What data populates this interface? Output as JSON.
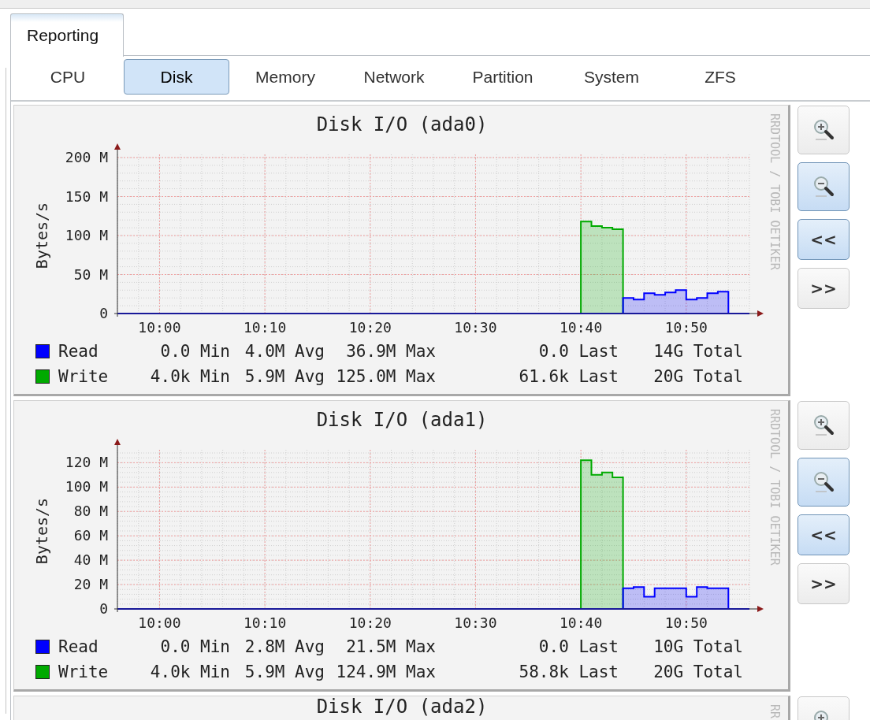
{
  "tabs": [
    {
      "label": "Reporting",
      "selected": true
    }
  ],
  "subtabs": [
    {
      "label": "CPU",
      "selected": false
    },
    {
      "label": "Disk",
      "selected": true
    },
    {
      "label": "Memory",
      "selected": false
    },
    {
      "label": "Network",
      "selected": false
    },
    {
      "label": "Partition",
      "selected": false
    },
    {
      "label": "System",
      "selected": false
    },
    {
      "label": "ZFS",
      "selected": false
    }
  ],
  "graphs": [
    {
      "watermark": "RRDTOOL / TOBI OETIKER",
      "chart_data": {
        "type": "area",
        "title": "Disk I/O (ada0)",
        "ylabel": "Bytes/s",
        "grid": true,
        "ylim": [
          0,
          200
        ],
        "categories": [
          null,
          null,
          null,
          null,
          "10:00",
          null,
          null,
          null,
          null,
          null,
          null,
          null,
          null,
          null,
          "10:10",
          null,
          null,
          null,
          null,
          null,
          null,
          null,
          null,
          null,
          "10:20",
          null,
          null,
          null,
          null,
          null,
          null,
          null,
          null,
          null,
          "10:30",
          null,
          null,
          null,
          null,
          null,
          null,
          null,
          null,
          null,
          "10:40",
          null,
          null,
          null,
          null,
          null,
          null,
          null,
          null,
          null,
          "10:50",
          null,
          null,
          null,
          null,
          null,
          null
        ],
        "series": [
          {
            "name": "Write",
            "color": "#00aa00",
            "values": [
              0,
              0,
              0,
              0,
              0,
              0,
              0,
              0,
              0,
              0,
              0,
              0,
              0,
              0,
              0,
              0,
              0,
              0,
              0,
              0,
              0,
              0,
              0,
              0,
              0,
              0,
              0,
              0,
              0,
              0,
              0,
              0,
              0,
              0,
              0,
              0,
              0,
              0,
              0,
              0,
              0,
              0,
              0,
              0,
              118,
              112,
              110,
              108,
              0,
              0,
              0,
              0,
              0,
              0,
              0,
              0,
              0,
              0,
              0,
              0,
              0
            ]
          },
          {
            "name": "Read",
            "color": "#0000ff",
            "values": [
              0,
              0,
              0,
              0,
              0,
              0,
              0,
              0,
              0,
              0,
              0,
              0,
              0,
              0,
              0,
              0,
              0,
              0,
              0,
              0,
              0,
              0,
              0,
              0,
              0,
              0,
              0,
              0,
              0,
              0,
              0,
              0,
              0,
              0,
              0,
              0,
              0,
              0,
              0,
              0,
              0,
              0,
              0,
              0,
              0,
              0,
              0,
              0,
              20,
              18,
              26,
              24,
              27,
              30,
              18,
              20,
              26,
              28,
              0,
              0,
              0
            ]
          }
        ],
        "yticks": [
          {
            "value": 0,
            "label": "0"
          },
          {
            "value": 50,
            "label": "50 M"
          },
          {
            "value": 100,
            "label": "100 M"
          },
          {
            "value": 150,
            "label": "150 M"
          },
          {
            "value": 200,
            "label": "200 M"
          }
        ]
      },
      "legend": [
        {
          "stats": [
            "0.0 Min",
            "4.0M Avg",
            "36.9M Max",
            "0.0 Last",
            "14G Total"
          ]
        },
        {
          "stats": [
            "4.0k Min",
            "5.9M Avg",
            "125.0M Max",
            "61.6k Last",
            "20G Total"
          ]
        }
      ],
      "buttons": [
        {
          "kind": "zoom-in",
          "highlighted": false
        },
        {
          "kind": "zoom-out",
          "highlighted": true
        },
        {
          "kind": "text",
          "label": "<<",
          "highlighted": true
        },
        {
          "kind": "text",
          "label": ">>",
          "highlighted": false
        }
      ]
    },
    {
      "watermark": "RRDTOOL / TOBI OETIKER",
      "chart_data": {
        "type": "area",
        "title": "Disk I/O (ada1)",
        "ylabel": "Bytes/s",
        "grid": true,
        "ylim": [
          0,
          128
        ],
        "categories": [
          null,
          null,
          null,
          null,
          "10:00",
          null,
          null,
          null,
          null,
          null,
          null,
          null,
          null,
          null,
          "10:10",
          null,
          null,
          null,
          null,
          null,
          null,
          null,
          null,
          null,
          "10:20",
          null,
          null,
          null,
          null,
          null,
          null,
          null,
          null,
          null,
          "10:30",
          null,
          null,
          null,
          null,
          null,
          null,
          null,
          null,
          null,
          "10:40",
          null,
          null,
          null,
          null,
          null,
          null,
          null,
          null,
          null,
          "10:50",
          null,
          null,
          null,
          null,
          null,
          null
        ],
        "series": [
          {
            "name": "Write",
            "color": "#00aa00",
            "values": [
              0,
              0,
              0,
              0,
              0,
              0,
              0,
              0,
              0,
              0,
              0,
              0,
              0,
              0,
              0,
              0,
              0,
              0,
              0,
              0,
              0,
              0,
              0,
              0,
              0,
              0,
              0,
              0,
              0,
              0,
              0,
              0,
              0,
              0,
              0,
              0,
              0,
              0,
              0,
              0,
              0,
              0,
              0,
              0,
              122,
              110,
              112,
              108,
              0,
              0,
              0,
              0,
              0,
              0,
              0,
              0,
              0,
              0,
              0,
              0,
              0
            ]
          },
          {
            "name": "Read",
            "color": "#0000ff",
            "values": [
              0,
              0,
              0,
              0,
              0,
              0,
              0,
              0,
              0,
              0,
              0,
              0,
              0,
              0,
              0,
              0,
              0,
              0,
              0,
              0,
              0,
              0,
              0,
              0,
              0,
              0,
              0,
              0,
              0,
              0,
              0,
              0,
              0,
              0,
              0,
              0,
              0,
              0,
              0,
              0,
              0,
              0,
              0,
              0,
              0,
              0,
              0,
              0,
              17,
              18,
              10,
              17,
              17,
              17,
              10,
              18,
              17,
              17,
              0,
              0,
              0
            ]
          }
        ],
        "yticks": [
          {
            "value": 0,
            "label": "0"
          },
          {
            "value": 20,
            "label": "20 M"
          },
          {
            "value": 40,
            "label": "40 M"
          },
          {
            "value": 60,
            "label": "60 M"
          },
          {
            "value": 80,
            "label": "80 M"
          },
          {
            "value": 100,
            "label": "100 M"
          },
          {
            "value": 120,
            "label": "120 M"
          }
        ]
      },
      "legend": [
        {
          "stats": [
            "0.0 Min",
            "2.8M Avg",
            "21.5M Max",
            "0.0 Last",
            "10G Total"
          ]
        },
        {
          "stats": [
            "4.0k Min",
            "5.9M Avg",
            "124.9M Max",
            "58.8k Last",
            "20G Total"
          ]
        }
      ],
      "buttons": [
        {
          "kind": "zoom-in",
          "highlighted": false
        },
        {
          "kind": "zoom-out",
          "highlighted": true
        },
        {
          "kind": "text",
          "label": "<<",
          "highlighted": true
        },
        {
          "kind": "text",
          "label": ">>",
          "highlighted": false
        }
      ]
    },
    {
      "watermark": "RR",
      "title": "Disk I/O (ada2)",
      "buttons": [
        {
          "kind": "zoom-in",
          "highlighted": false
        }
      ]
    }
  ]
}
